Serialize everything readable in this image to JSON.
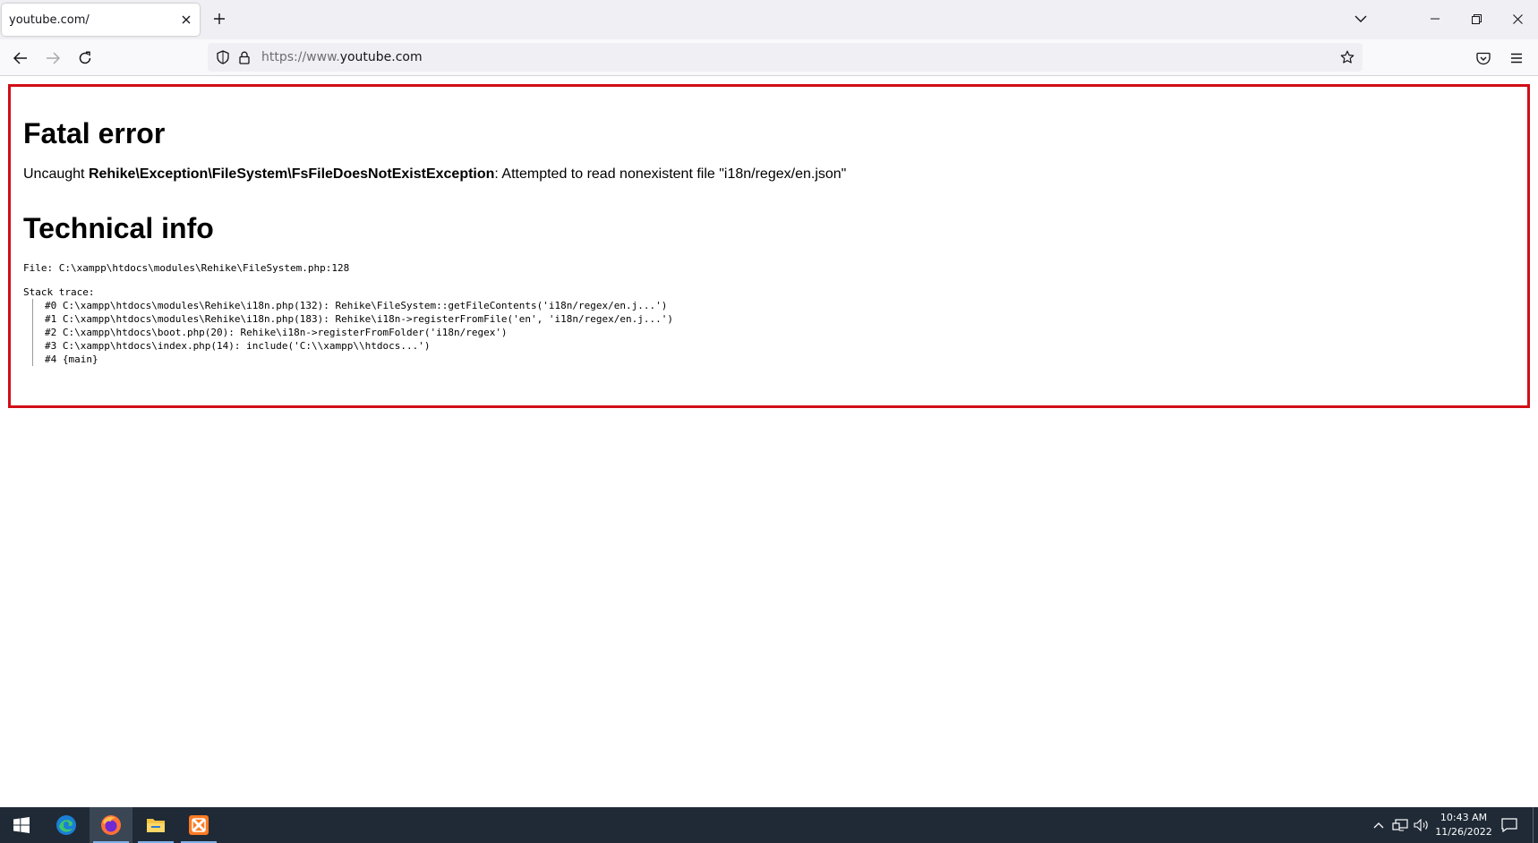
{
  "browser": {
    "tab": {
      "title": "youtube.com/"
    },
    "url": {
      "scheme": "https://www.",
      "host": "youtube.com"
    }
  },
  "page": {
    "heading": "Fatal error",
    "message": {
      "prefix": "Uncaught ",
      "exception": "Rehike\\Exception\\FileSystem\\FsFileDoesNotExistException",
      "suffix": ": Attempted to read nonexistent file \"i18n/regex/en.json\""
    },
    "technical_heading": "Technical info",
    "file_line": "File: C:\\xampp\\htdocs\\modules\\Rehike\\FileSystem.php:128",
    "stack_label": "Stack trace:",
    "stack_trace": [
      "#0 C:\\xampp\\htdocs\\modules\\Rehike\\i18n.php(132): Rehike\\FileSystem::getFileContents('i18n/regex/en.j...')",
      "#1 C:\\xampp\\htdocs\\modules\\Rehike\\i18n.php(183): Rehike\\i18n->registerFromFile('en', 'i18n/regex/en.j...')",
      "#2 C:\\xampp\\htdocs\\boot.php(20): Rehike\\i18n->registerFromFolder('i18n/regex')",
      "#3 C:\\xampp\\htdocs\\index.php(14): include('C:\\\\xampp\\\\htdocs...')",
      "#4 {main}"
    ]
  },
  "taskbar": {
    "apps": [
      "start-icon",
      "edge-icon",
      "firefox-icon",
      "file-explorer-icon",
      "xampp-icon"
    ],
    "clock": {
      "time": "10:43 AM",
      "date": "11/26/2022"
    }
  },
  "colors": {
    "error_border": "#d10e16",
    "taskbar": "#1f2a36"
  }
}
